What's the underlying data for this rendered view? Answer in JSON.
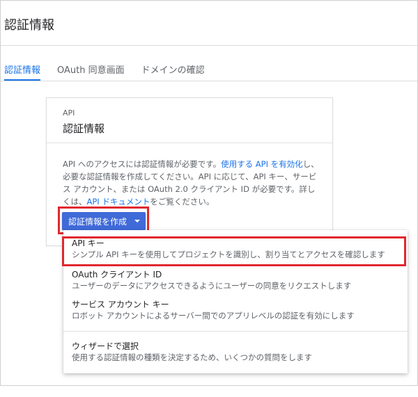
{
  "header": {
    "title": "認証情報"
  },
  "tabs": [
    {
      "label": "認証情報",
      "active": true
    },
    {
      "label": "OAuth 同意画面",
      "active": false
    },
    {
      "label": "ドメインの確認",
      "active": false
    }
  ],
  "card": {
    "kicker": "API",
    "title": "認証情報",
    "body": {
      "t1": "API へのアクセスには認証情報が必要です。",
      "link1": "使用する API を有効化",
      "t2": "し、必要な認証情報を作成してください。API に応じて、API キー、サービス アカウント、または OAuth 2.0 クライアント ID が必要です。詳しくは、",
      "link2": "API ドキュメント",
      "t3": "をご覧ください。"
    },
    "create_button_label": "認証情報を作成"
  },
  "menu": {
    "items": [
      {
        "title": "API キー",
        "desc": "シンプル API キーを使用してプロジェクトを識別し、割り当てとアクセスを確認します"
      },
      {
        "title": "OAuth クライアント ID",
        "desc": "ユーザーのデータにアクセスできるようにユーザーの同意をリクエストします"
      },
      {
        "title": "サービス アカウント キー",
        "desc": "ロボット アカウントによるサーバー間でのアプリレベルの認証を有効にします"
      },
      {
        "title": "ウィザードで選択",
        "desc": "使用する認証情報の種類を決定するため、いくつかの質問をします"
      }
    ]
  },
  "colors": {
    "accent": "#1a73e8",
    "button": "#3f6ad8",
    "highlight": "#e0282e"
  }
}
